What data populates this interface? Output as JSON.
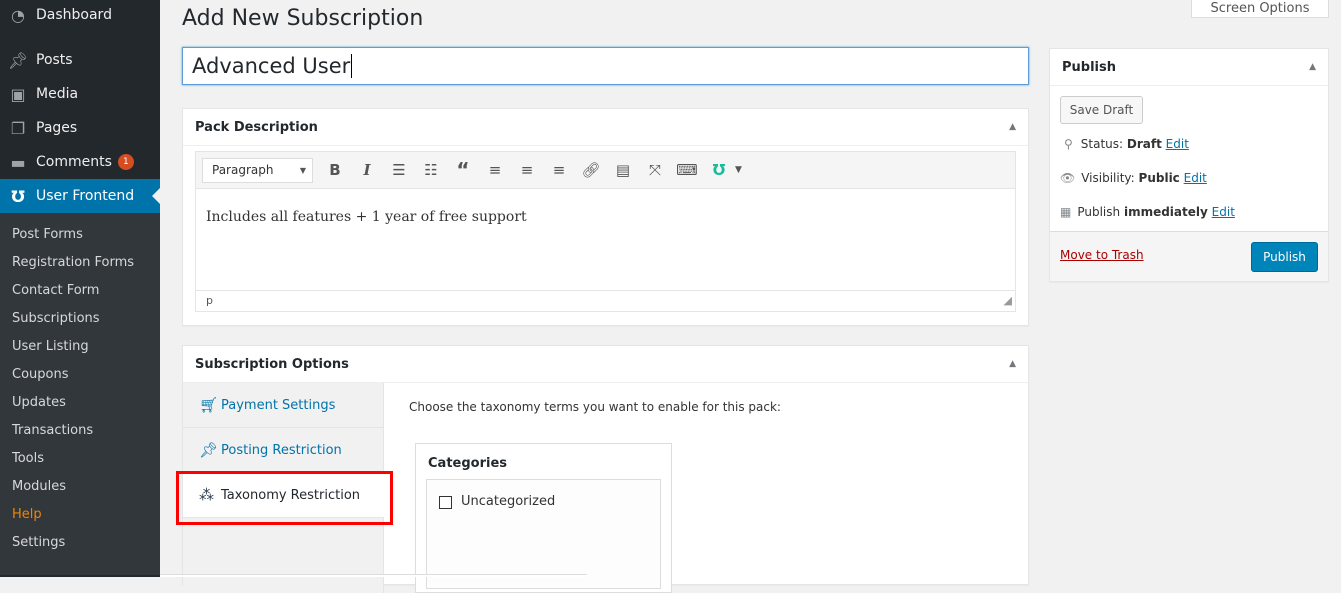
{
  "sidebar": {
    "items": [
      {
        "label": "Dashboard",
        "icon": "dashboard-icon"
      },
      {
        "label": "Posts",
        "icon": "pin-icon"
      },
      {
        "label": "Media",
        "icon": "media-icon"
      },
      {
        "label": "Pages",
        "icon": "pages-icon"
      },
      {
        "label": "Comments",
        "icon": "comment-icon",
        "badge": "1"
      },
      {
        "label": "User Frontend",
        "icon": "user-frontend-icon",
        "current": true
      }
    ],
    "submenu": [
      "Post Forms",
      "Registration Forms",
      "Contact Form",
      "Subscriptions",
      "User Listing",
      "Coupons",
      "Updates",
      "Transactions",
      "Tools",
      "Modules",
      "Help",
      "Settings"
    ]
  },
  "header": {
    "title": "Add New Subscription",
    "screen_options": "Screen Options"
  },
  "title_input": {
    "value": "Advanced User"
  },
  "pack_description": {
    "title": "Pack Description",
    "format": "Paragraph",
    "content": "Includes all features + 1 year of free support",
    "path": "p"
  },
  "subscription_options": {
    "title": "Subscription Options",
    "tabs": [
      {
        "label": "Payment Settings",
        "icon": "cart-icon"
      },
      {
        "label": "Posting Restriction",
        "icon": "pin-icon"
      },
      {
        "label": "Taxonomy Restriction",
        "icon": "taxonomy-icon",
        "active": true
      }
    ],
    "instruction": "Choose the taxonomy terms you want to enable for this pack:",
    "categories_title": "Categories",
    "categories": [
      {
        "label": "Uncategorized",
        "checked": false
      }
    ]
  },
  "publish": {
    "title": "Publish",
    "save_draft": "Save Draft",
    "status_label": "Status:",
    "status": "Draft",
    "visibility_label": "Visibility:",
    "visibility": "Public",
    "publish_label": "Publish",
    "publish_when": "immediately",
    "edit": "Edit",
    "trash": "Move to Trash",
    "publish_button": "Publish"
  },
  "colors": {
    "accent": "#0073aa",
    "highlight": "#ff0000",
    "sidebar": "#23282d"
  }
}
